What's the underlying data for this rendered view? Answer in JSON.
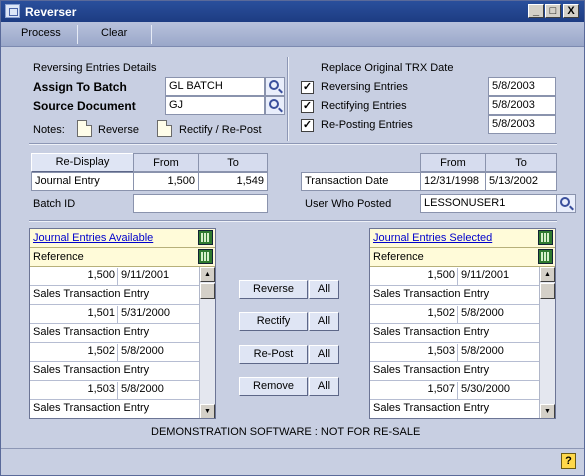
{
  "window": {
    "title": "Reverser",
    "btn_min": "_",
    "btn_max": "□",
    "btn_close": "X"
  },
  "toolbar": {
    "process": "Process",
    "clear": "Clear"
  },
  "reversing": {
    "heading": "Reversing Entries Details",
    "assign_label": "Assign To Batch",
    "assign_value": "GL BATCH",
    "source_label": "Source Document",
    "source_value": "GJ",
    "notes_label": "Notes:",
    "reverse_note": "Reverse",
    "rectify_note": "Rectify / Re-Post"
  },
  "replace": {
    "heading": "Replace Original TRX Date",
    "items": [
      {
        "label": "Reversing Entries",
        "checked": true,
        "date": "5/8/2003"
      },
      {
        "label": "Rectifying Entries",
        "checked": true,
        "date": "5/8/2003"
      },
      {
        "label": "Re-Posting Entries",
        "checked": true,
        "date": "5/8/2003"
      }
    ]
  },
  "range": {
    "redisplay": "Re-Display",
    "from": "From",
    "to": "To",
    "journal_label": "Journal Entry",
    "journal_from": "1,500",
    "journal_to": "1,549",
    "batch_label": "Batch ID",
    "batch_value": ""
  },
  "trxrange": {
    "from": "From",
    "to": "To",
    "date_label": "Transaction Date",
    "date_from": "12/31/1998",
    "date_to": "5/13/2002",
    "user_label": "User Who Posted",
    "user_value": "LESSONUSER1"
  },
  "available": {
    "title": "Journal Entries Available",
    "sub": "Reference",
    "rows": [
      {
        "num": "1,500",
        "date": "9/11/2001",
        "ref": "Sales Transaction Entry"
      },
      {
        "num": "1,501",
        "date": "5/31/2000",
        "ref": "Sales Transaction Entry"
      },
      {
        "num": "1,502",
        "date": "5/8/2000",
        "ref": "Sales Transaction Entry"
      },
      {
        "num": "1,503",
        "date": "5/8/2000",
        "ref": "Sales Transaction Entry"
      }
    ]
  },
  "selected": {
    "title": "Journal Entries Selected",
    "sub": "Reference",
    "rows": [
      {
        "num": "1,500",
        "date": "9/11/2001",
        "ref": "Sales Transaction Entry"
      },
      {
        "num": "1,502",
        "date": "5/8/2000",
        "ref": "Sales Transaction Entry"
      },
      {
        "num": "1,503",
        "date": "5/8/2000",
        "ref": "Sales Transaction Entry"
      },
      {
        "num": "1,507",
        "date": "5/30/2000",
        "ref": "Sales Transaction Entry"
      }
    ]
  },
  "actions": {
    "reverse": "Reverse",
    "rectify": "Rectify",
    "repost": "Re-Post",
    "remove": "Remove",
    "all": "All"
  },
  "footer": {
    "demo": "DEMONSTRATION SOFTWARE : NOT FOR RE-SALE",
    "help": "?"
  },
  "colors": {
    "title_bar": "#1d3c82",
    "background": "#c8cfe2",
    "list_header": "#fffbd9"
  }
}
